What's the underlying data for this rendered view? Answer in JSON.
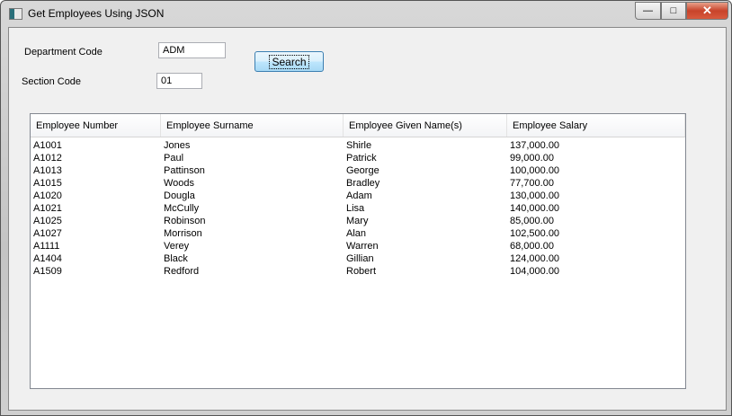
{
  "window": {
    "title": "Get Employees Using JSON",
    "close_label": "✕",
    "max_label": "□",
    "min_label": "—"
  },
  "form": {
    "department_label": "Department Code",
    "department_value": "ADM",
    "section_label": "Section Code",
    "section_value": "01",
    "search_label": "Search"
  },
  "table": {
    "headers": [
      "Employee Number",
      "Employee Surname",
      "Employee Given Name(s)",
      "Employee Salary"
    ],
    "rows": [
      [
        "A1001",
        "Jones",
        "Shirle",
        "137,000.00"
      ],
      [
        "A1012",
        "Paul",
        "Patrick",
        "99,000.00"
      ],
      [
        "A1013",
        "Pattinson",
        "George",
        "100,000.00"
      ],
      [
        "A1015",
        "Woods",
        "Bradley",
        "77,700.00"
      ],
      [
        "A1020",
        "Dougla",
        "Adam",
        "130,000.00"
      ],
      [
        "A1021",
        "McCully",
        "Lisa",
        "140,000.00"
      ],
      [
        "A1025",
        "Robinson",
        "Mary",
        "85,000.00"
      ],
      [
        "A1027",
        "Morrison",
        "Alan",
        "102,500.00"
      ],
      [
        "A1111",
        "Verey",
        "Warren",
        "68,000.00"
      ],
      [
        "A1404",
        "Black",
        "Gillian",
        "124,000.00"
      ],
      [
        "A1509",
        "Redford",
        "Robert",
        "104,000.00"
      ]
    ]
  }
}
